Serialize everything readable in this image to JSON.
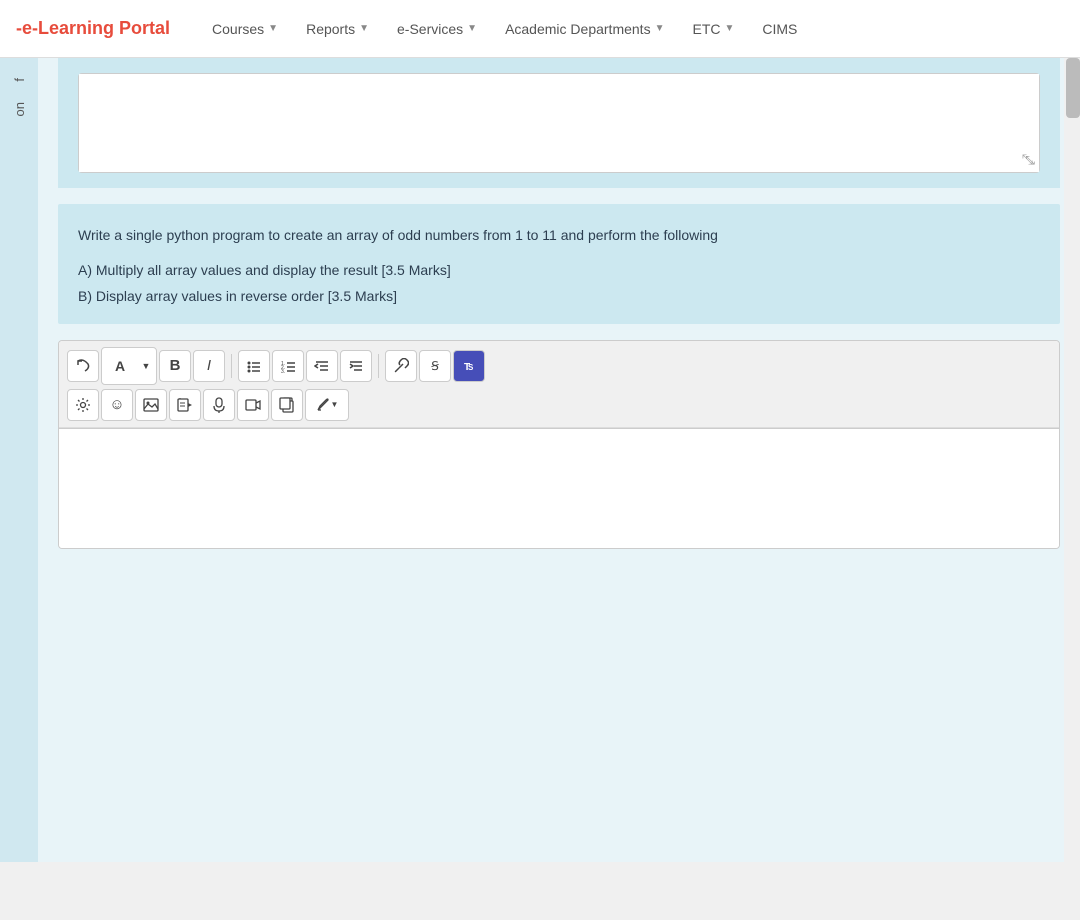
{
  "navbar": {
    "brand": "e-Learning Portal",
    "items": [
      {
        "label": "Courses",
        "hasDropdown": true
      },
      {
        "label": "Reports",
        "hasDropdown": true
      },
      {
        "label": "e-Services",
        "hasDropdown": true
      },
      {
        "label": "Academic Departments",
        "hasDropdown": true
      },
      {
        "label": "ETC",
        "hasDropdown": true
      },
      {
        "label": "CIMS",
        "hasDropdown": false
      }
    ]
  },
  "sidebar": {
    "letters": [
      "f",
      "on"
    ]
  },
  "question": {
    "text": "Write a single python program to create an array of odd numbers from 1 to 11 and perform the following",
    "partA": "A) Multiply all array values and display the result [3.5 Marks]",
    "partB": "B) Display array values in reverse order [3.5 Marks]"
  },
  "toolbar": {
    "row1": {
      "undo": "↩",
      "font": "A",
      "bold": "B",
      "italic": "I",
      "unordered_list": "≡",
      "ordered_list": "≡",
      "indent_decrease": "⇤",
      "indent_increase": "⇥",
      "link": "⚲",
      "special_chars": "Ꞩ",
      "teams": "T"
    },
    "row2": {
      "settings": "⚙",
      "emoji": "☺",
      "image": "🖼",
      "video_file": "📄",
      "audio": "🎤",
      "video": "🎬",
      "copy": "⧉",
      "pen": "✒"
    }
  }
}
